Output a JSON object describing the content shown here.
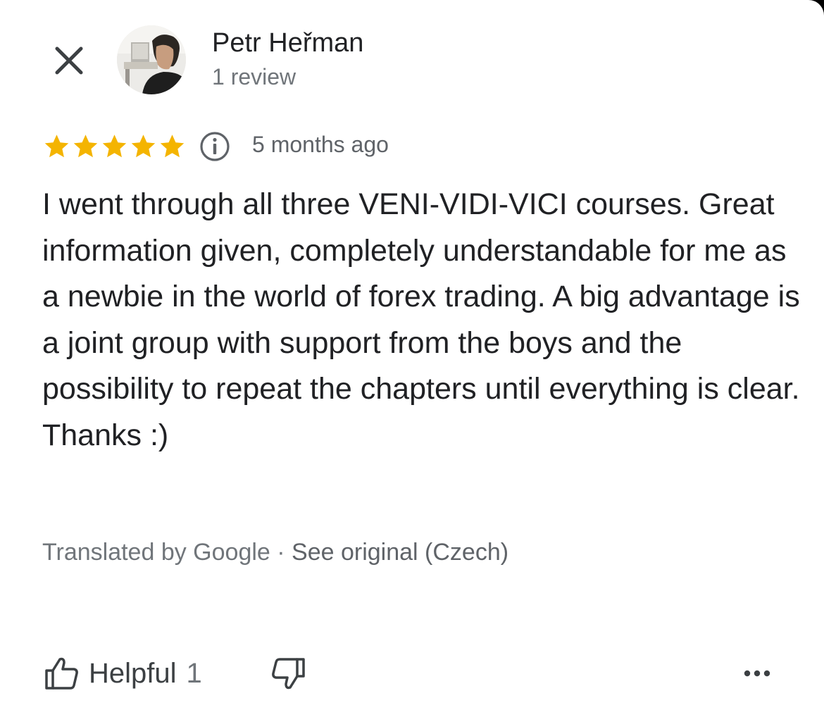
{
  "header": {
    "close_icon": "close-icon",
    "reviewer_name": "Petr Heřman",
    "reviewer_reviews": "1 review",
    "avatar_icon": "user-avatar"
  },
  "rating": {
    "stars": 5,
    "max_stars": 5,
    "star_color": "#F4B400",
    "info_icon": "info-icon",
    "time_ago": "5 months ago"
  },
  "review": {
    "text": "I went through all three VENI-VIDI-VICI courses. Great information given, completely understandable for me as a newbie in the world of forex trading. A big advantage is a joint group with support from the boys and the possibility to repeat the chapters until everything is clear. Thanks :)"
  },
  "translation": {
    "prefix": "Translated by Google",
    "separator": " · ",
    "link": "See original (Czech)"
  },
  "actions": {
    "helpful_label": "Helpful",
    "helpful_count": "1",
    "like_icon": "thumbs-up-icon",
    "dislike_icon": "thumbs-down-icon",
    "more_icon": "more-horizontal-icon"
  },
  "colors": {
    "text_primary": "#202124",
    "text_secondary": "#70757a",
    "star": "#F4B400",
    "icon": "#3c4043"
  }
}
